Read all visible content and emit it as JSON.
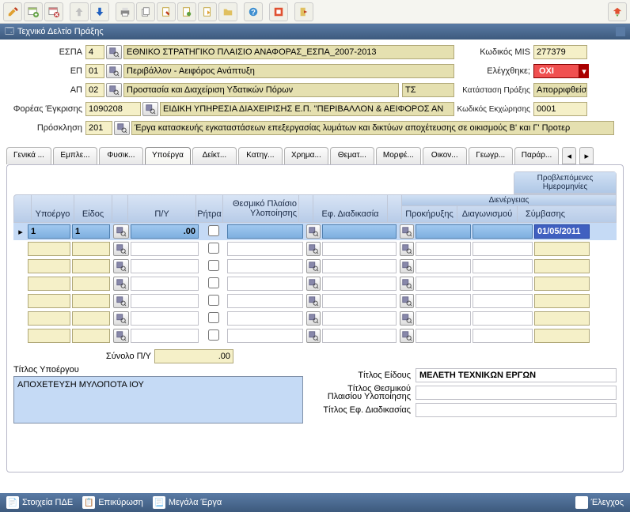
{
  "window": {
    "title": "Τεχνικό Δελτίο Πράξης"
  },
  "header": {
    "labels": {
      "espa": "ΕΣΠΑ",
      "ep": "ΕΠ",
      "ap": "ΑΠ",
      "foreas": "Φορέας Έγκρισης",
      "prosklisi": "Πρόσκληση",
      "kodikos_mis": "Κωδικός MIS",
      "elegxthike": "Ελέγχθηκε;",
      "katastasi_praxis": "Κατάσταση Πράξης",
      "kodikos_ekx": "Κωδικός Εκχώρησης"
    },
    "espa_code": "4",
    "espa_desc": "ΕΘΝΙΚΟ ΣΤΡΑΤΗΓΙΚΟ ΠΛΑΙΣΙΟ ΑΝΑΦΟΡΑΣ_ΕΣΠΑ_2007-2013",
    "ep_code": "01",
    "ep_desc": "Περιβάλλον - Αειφόρος Ανάπτυξη",
    "ap_code": "02",
    "ap_desc": "Προστασία και Διαχείριση Υδατικών Πόρων",
    "ap_ts": "ΤΣ",
    "foreas_code": "1090208",
    "foreas_desc": "ΕΙΔΙΚΗ ΥΠΗΡΕΣΙΑ ΔΙΑΧΕΙΡΙΣΗΣ Ε.Π. \"ΠΕΡΙΒΑΛΛΟΝ & ΑΕΙΦΟΡΟΣ ΑΝ",
    "prosklisi_code": "201",
    "prosklisi_desc": "Έργα κατασκευής εγκαταστάσεων επεξεργασίας λυμάτων και δικτύων αποχέτευσης σε οικισμούς Β' και Γ' Προτερ",
    "kodikos_mis": "277379",
    "elegxthike": "ΟΧΙ",
    "katastasi_praxis": "Απορριφθείσα",
    "kodikos_ekx": "0001"
  },
  "tabs": {
    "items": [
      "Γενικά ...",
      "Εμπλε...",
      "Φυσικ...",
      "Υποέργα",
      "Δείκτ...",
      "Κατηγ...",
      "Χρημα...",
      "Θεματ...",
      "Μορφέ...",
      "Οικον...",
      "Γεωγρ...",
      "Παράρ..."
    ],
    "active_index": 3
  },
  "grid": {
    "header_group": "Προβλεπόμενες Ημερομηνίες",
    "header_sub": "Διενέργειας",
    "cols": {
      "ypoergo": "Υποέργο",
      "eidos": "Είδος",
      "py": "Π/Υ",
      "ritra": "Ρήτρα",
      "thesmiko1": "Θεσμικό Πλαίσιο",
      "thesmiko2": "Υλοποίησης",
      "ef": "Εφ. Διαδικασία",
      "prok": "Προκήρυξης",
      "diag": "Διαγωνισμού",
      "sym": "Σύμβασης"
    },
    "rows": [
      {
        "ypoergo": "1",
        "eidos": "1",
        "py": ".00",
        "ritra": false,
        "thes": "",
        "ef": "",
        "prok": "",
        "diag": "",
        "sym": "01/05/2011"
      },
      {
        "ypoergo": "",
        "eidos": "",
        "py": "",
        "ritra": false,
        "thes": "",
        "ef": "",
        "prok": "",
        "diag": "",
        "sym": ""
      },
      {
        "ypoergo": "",
        "eidos": "",
        "py": "",
        "ritra": false,
        "thes": "",
        "ef": "",
        "prok": "",
        "diag": "",
        "sym": ""
      },
      {
        "ypoergo": "",
        "eidos": "",
        "py": "",
        "ritra": false,
        "thes": "",
        "ef": "",
        "prok": "",
        "diag": "",
        "sym": ""
      },
      {
        "ypoergo": "",
        "eidos": "",
        "py": "",
        "ritra": false,
        "thes": "",
        "ef": "",
        "prok": "",
        "diag": "",
        "sym": ""
      },
      {
        "ypoergo": "",
        "eidos": "",
        "py": "",
        "ritra": false,
        "thes": "",
        "ef": "",
        "prok": "",
        "diag": "",
        "sym": ""
      },
      {
        "ypoergo": "",
        "eidos": "",
        "py": "",
        "ritra": false,
        "thes": "",
        "ef": "",
        "prok": "",
        "diag": "",
        "sym": ""
      }
    ],
    "sum_label": "Σύνολο Π/Υ",
    "sum_value": ".00"
  },
  "bottom": {
    "titlos_ypoergou_label": "Τίτλος Υποέργου",
    "titlos_ypoergou": "ΑΠΟΧΕΤΕΥΣΗ ΜΥΛΟΠΟΤΑ ΙΟΥ",
    "titlos_eidous_label": "Τίτλος Είδους",
    "titlos_eidous": "ΜΕΛΕΤΗ ΤΕΧΝΙΚΩΝ ΕΡΓΩΝ",
    "titlos_thesmikou_label": "Τίτλος Θεσμικού Πλαισίου Υλοποίησης",
    "titlos_thesmikou": "",
    "titlos_ef_label": "Τίτλος Εφ. Διαδικασίας",
    "titlos_ef": ""
  },
  "statusbar": {
    "stoixeia": "Στοιχεία ΠΔΕ",
    "epikyrosi": "Επικύρωση",
    "megala": "Μεγάλα Έργα",
    "elegxos": "Έλεγχος"
  }
}
